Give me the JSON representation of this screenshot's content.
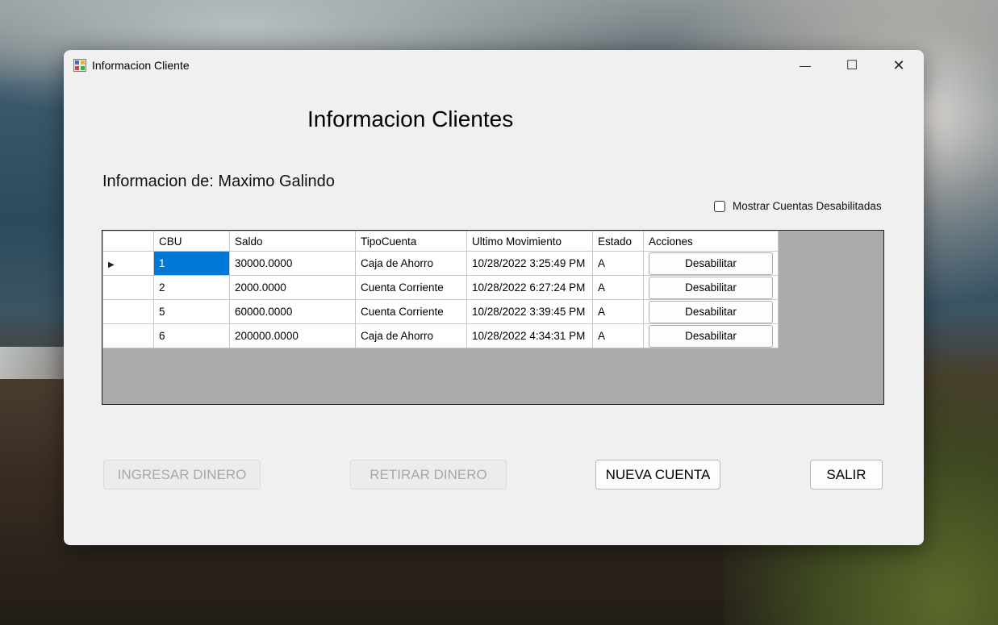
{
  "window": {
    "title": "Informacion Cliente",
    "minimize_glyph": "—",
    "maximize_glyph": "☐",
    "close_glyph": "✕"
  },
  "heading": "Informacion Clientes",
  "client_info": "Informacion de: Maximo Galindo",
  "show_disabled": {
    "label": "Mostrar Cuentas Desabilitadas",
    "checked": false
  },
  "table": {
    "columns": [
      "CBU",
      "Saldo",
      "TipoCuenta",
      "Ultimo Movimiento",
      "Estado",
      "Acciones"
    ],
    "selected_row_marker": "▶",
    "rows": [
      {
        "cbu": "1",
        "saldo": "30000.0000",
        "tipo": "Caja de Ahorro",
        "ultimo": "10/28/2022 3:25:49 PM",
        "estado": "A",
        "accion": "Desabilitar"
      },
      {
        "cbu": "2",
        "saldo": "2000.0000",
        "tipo": "Cuenta Corriente",
        "ultimo": "10/28/2022 6:27:24 PM",
        "estado": "A",
        "accion": "Desabilitar"
      },
      {
        "cbu": "5",
        "saldo": "60000.0000",
        "tipo": "Cuenta Corriente",
        "ultimo": "10/28/2022 3:39:45 PM",
        "estado": "A",
        "accion": "Desabilitar"
      },
      {
        "cbu": "6",
        "saldo": "200000.0000",
        "tipo": "Caja de Ahorro",
        "ultimo": "10/28/2022 4:34:31 PM",
        "estado": "A",
        "accion": "Desabilitar"
      }
    ]
  },
  "buttons": {
    "ingresar": "INGRESAR DINERO",
    "retirar": "RETIRAR DINERO",
    "nueva": "NUEVA CUENTA",
    "salir": "SALIR"
  },
  "colors": {
    "selection": "#0078d7",
    "grid_background": "#ababab",
    "window_background": "#f0f0f0"
  }
}
